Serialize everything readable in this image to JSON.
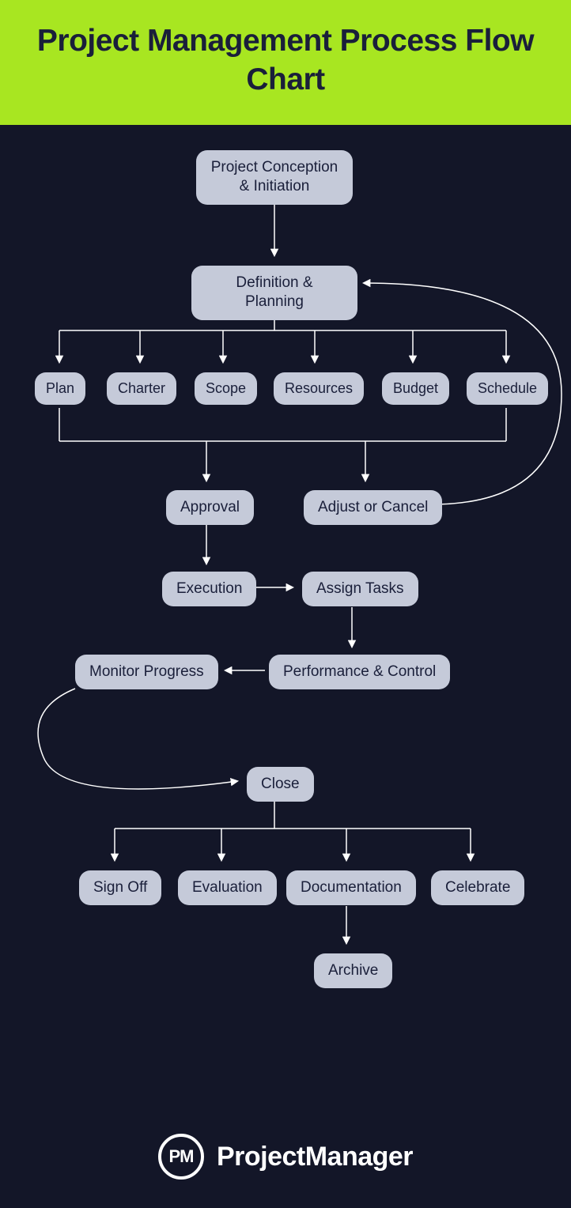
{
  "title": "Project Management\nProcess Flow Chart",
  "nodes": {
    "conception": "Project Conception\n& Initiation",
    "definition": "Definition & Planning",
    "plan": "Plan",
    "charter": "Charter",
    "scope": "Scope",
    "resources": "Resources",
    "budget": "Budget",
    "schedule": "Schedule",
    "approval": "Approval",
    "adjust": "Adjust or Cancel",
    "execution": "Execution",
    "assign": "Assign Tasks",
    "monitor": "Monitor Progress",
    "performance": "Performance & Control",
    "close": "Close",
    "signoff": "Sign Off",
    "evaluation": "Evaluation",
    "documentation": "Documentation",
    "celebrate": "Celebrate",
    "archive": "Archive"
  },
  "logo": {
    "initials": "PM",
    "name": "ProjectManager"
  }
}
